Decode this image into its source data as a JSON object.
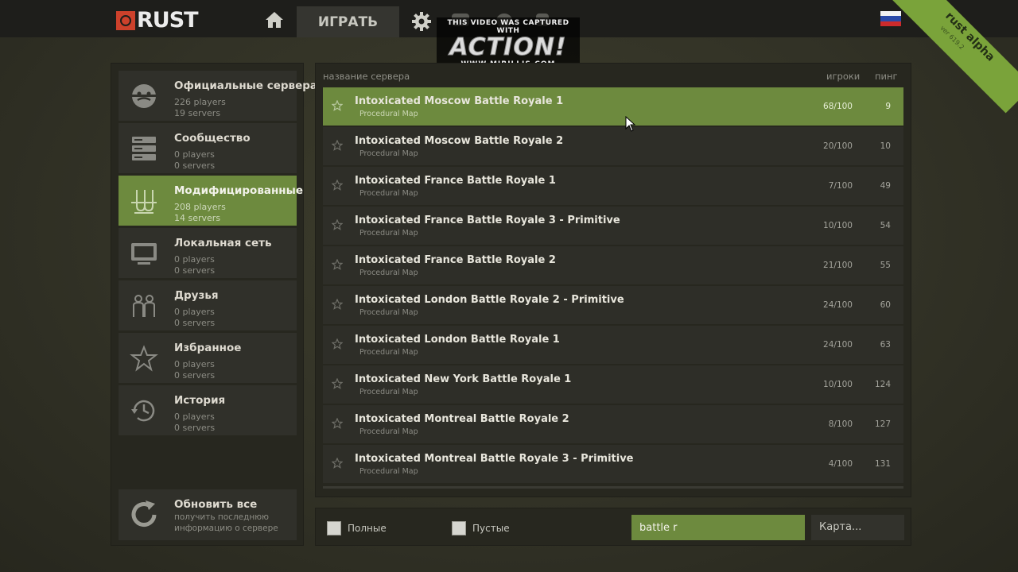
{
  "header": {
    "logo_text": "RUST",
    "play_tab": "ИГРАТЬ",
    "watermark": {
      "line1": "THIS VIDEO WAS CAPTURED WITH",
      "line2": "ACTION!",
      "line3": "WWW.MIRILLIS.COM"
    },
    "banner": {
      "title": "rust alpha",
      "version": "ver 619.2"
    }
  },
  "categories": [
    {
      "name": "Официальные сервера",
      "players": "226 players",
      "servers": "19 servers",
      "icon": "face-icon"
    },
    {
      "name": "Сообщество",
      "players": "0 players",
      "servers": "0 servers",
      "icon": "server-rack-icon"
    },
    {
      "name": "Модифицированные",
      "players": "208 players",
      "servers": "14 servers",
      "icon": "flask-icon",
      "active": true
    },
    {
      "name": "Локальная сеть",
      "players": "0 players",
      "servers": "0 servers",
      "icon": "monitor-icon"
    },
    {
      "name": "Друзья",
      "players": "0 players",
      "servers": "0 servers",
      "icon": "friends-icon"
    },
    {
      "name": "Избранное",
      "players": "0 players",
      "servers": "0 servers",
      "icon": "star-icon"
    },
    {
      "name": "История",
      "players": "0 players",
      "servers": "0 servers",
      "icon": "history-icon"
    }
  ],
  "refresh": {
    "title": "Обновить все",
    "desc_line1": "получить последнюю",
    "desc_line2": "информацию о сервере"
  },
  "list": {
    "headers": {
      "name": "название сервера",
      "players": "игроки",
      "ping": "пинг"
    },
    "rows": [
      {
        "name": "Intoxicated Moscow Battle Royale 1",
        "map": "Procedural Map",
        "players": "68/100",
        "ping": "9",
        "selected": true
      },
      {
        "name": "Intoxicated Moscow Battle Royale 2",
        "map": "Procedural Map",
        "players": "20/100",
        "ping": "10"
      },
      {
        "name": "Intoxicated France Battle Royale 1",
        "map": "Procedural Map",
        "players": "7/100",
        "ping": "49"
      },
      {
        "name": "Intoxicated France Battle Royale 3 - Primitive",
        "map": "Procedural Map",
        "players": "10/100",
        "ping": "54"
      },
      {
        "name": "Intoxicated France Battle Royale 2",
        "map": "Procedural Map",
        "players": "21/100",
        "ping": "55"
      },
      {
        "name": "Intoxicated London Battle Royale 2 - Primitive",
        "map": "Procedural Map",
        "players": "24/100",
        "ping": "60"
      },
      {
        "name": "Intoxicated London Battle Royale 1",
        "map": "Procedural Map",
        "players": "24/100",
        "ping": "63"
      },
      {
        "name": "Intoxicated New York Battle Royale 1",
        "map": "Procedural Map",
        "players": "10/100",
        "ping": "124"
      },
      {
        "name": "Intoxicated Montreal Battle Royale 2",
        "map": "Procedural Map",
        "players": "8/100",
        "ping": "127"
      },
      {
        "name": "Intoxicated Montreal Battle Royale 3 - Primitive",
        "map": "Procedural Map",
        "players": "4/100",
        "ping": "131"
      }
    ]
  },
  "filters": {
    "full_label": "Полные",
    "empty_label": "Пустые",
    "search_value": "battle r",
    "map_button": "Карта..."
  },
  "colors": {
    "accent_green": "#6d8a3e",
    "logo_red": "#cd412b",
    "banner_green": "#7aa33a"
  }
}
